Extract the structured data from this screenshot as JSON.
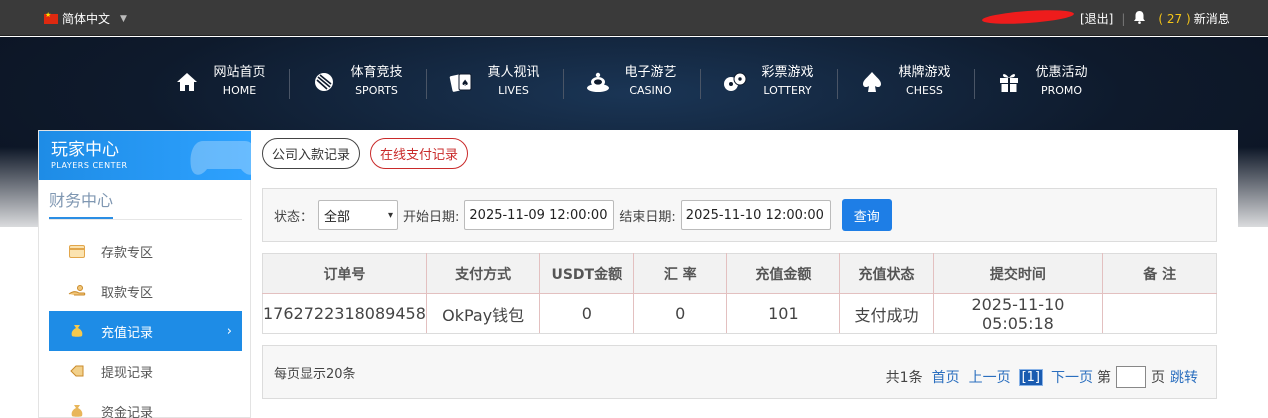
{
  "topbar": {
    "language": "简体中文",
    "logout": "[退出]",
    "messages_count": "( 27 )",
    "messages_label": "新消息"
  },
  "nav": [
    {
      "cn": "网站首页",
      "en": "HOME",
      "icon": "home-icon"
    },
    {
      "cn": "体育竞技",
      "en": "SPORTS",
      "icon": "soccer-ball-icon"
    },
    {
      "cn": "真人视讯",
      "en": "LIVES",
      "icon": "cards-icon"
    },
    {
      "cn": "电子游艺",
      "en": "CASINO",
      "icon": "slot-machine-icon"
    },
    {
      "cn": "彩票游戏",
      "en": "LOTTERY",
      "icon": "lottery-balls-icon"
    },
    {
      "cn": "棋牌游戏",
      "en": "CHESS",
      "icon": "spade-icon"
    },
    {
      "cn": "优惠活动",
      "en": "PROMO",
      "icon": "gift-icon"
    }
  ],
  "sidebar": {
    "title_cn": "玩家中心",
    "title_en": "PLAYERS CENTER",
    "section": "财务中心",
    "items": [
      {
        "label": "存款专区",
        "icon": "deposit-card-icon"
      },
      {
        "label": "取款专区",
        "icon": "withdraw-hand-icon"
      },
      {
        "label": "充值记录",
        "icon": "money-bag-icon",
        "active": true
      },
      {
        "label": "提现记录",
        "icon": "withdraw-record-icon"
      },
      {
        "label": "资金记录",
        "icon": "funds-record-icon"
      }
    ]
  },
  "tabs": [
    {
      "label": "公司入款记录",
      "active": false
    },
    {
      "label": "在线支付记录",
      "active": true
    }
  ],
  "filters": {
    "status_label": "状态：",
    "status_value": "全部",
    "start_label": "开始日期:",
    "start_value": "2025-11-09 12:00:00",
    "end_label": "结束日期:",
    "end_value": "2025-11-10 12:00:00",
    "query_button": "查询"
  },
  "table": {
    "headers": [
      "订单号",
      "支付方式",
      "USDT金额",
      "汇 率",
      "充值金额",
      "充值状态",
      "提交时间",
      "备 注"
    ],
    "rows": [
      [
        "1762722318089458",
        "OkPay钱包",
        "0",
        "0",
        "101",
        "支付成功",
        "2025-11-10 05:05:18",
        ""
      ]
    ]
  },
  "pagination": {
    "per_page": "每页显示20条",
    "total": "共1条",
    "first": "首页",
    "prev": "上一页",
    "current": "[1]",
    "next": "下一页",
    "goto_prefix": "第",
    "goto_suffix": "页",
    "jump": "跳转"
  },
  "colors": {
    "accent": "#1e8ce6",
    "active_tab": "#c92a2a",
    "topbar": "#3a3a3a",
    "highlight": "#f5c518"
  }
}
